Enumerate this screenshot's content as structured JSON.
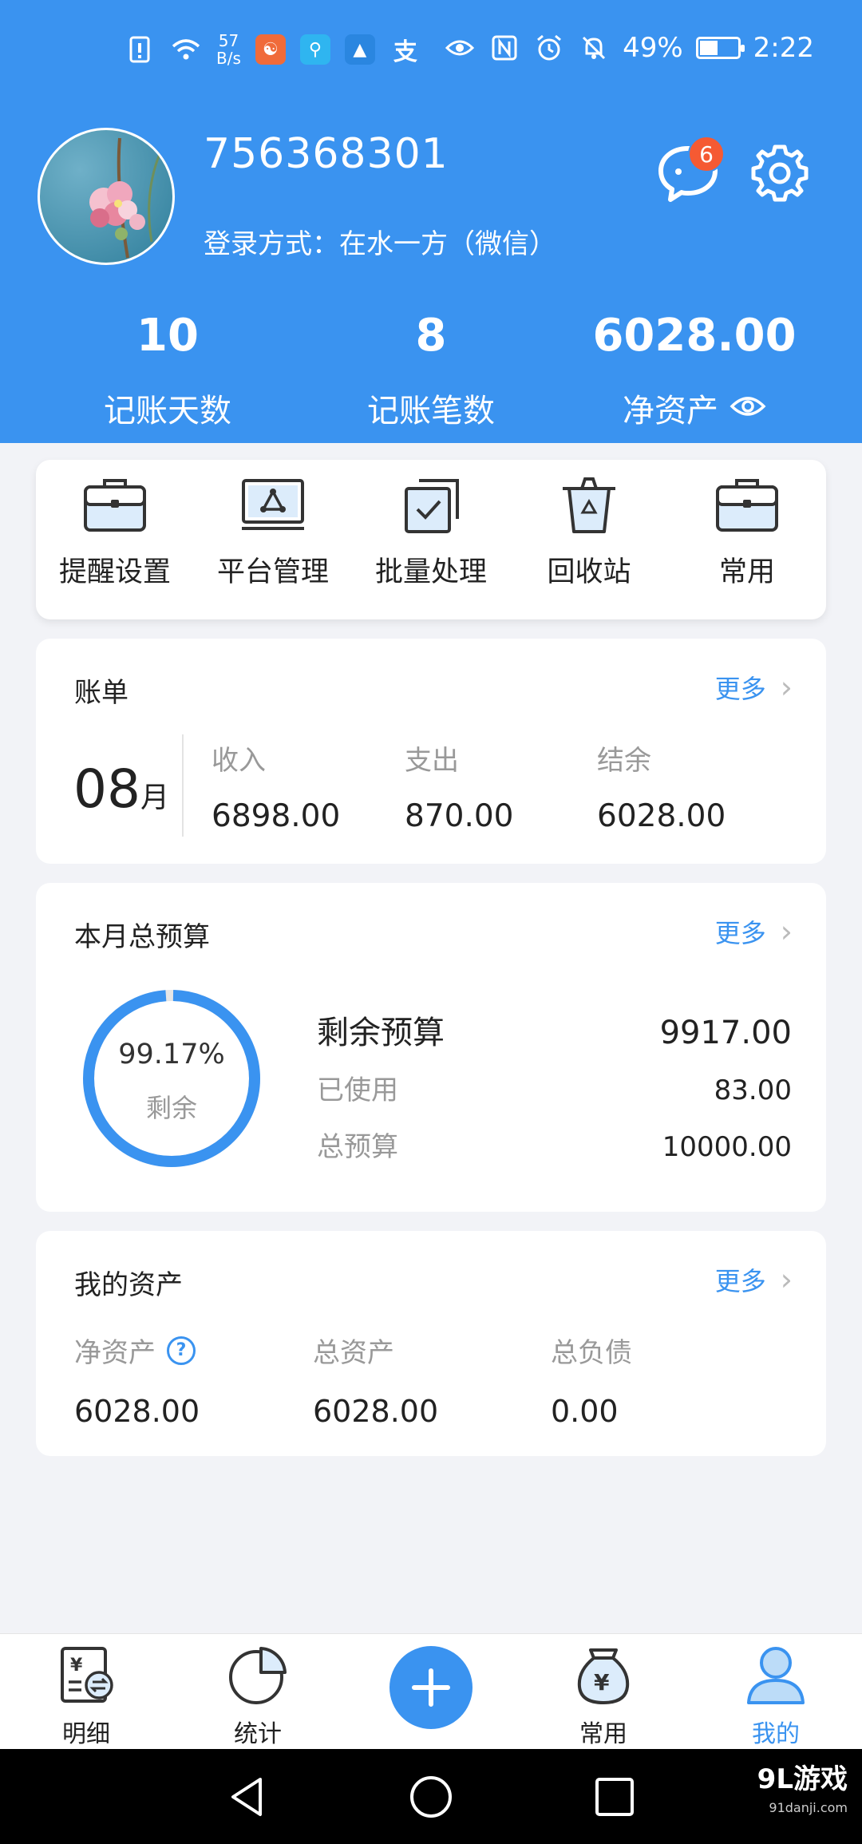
{
  "status_bar": {
    "net_speed_value": "57",
    "net_speed_unit": "B/s",
    "battery": "49%",
    "time": "2:22"
  },
  "profile": {
    "user_id": "756368301",
    "login_method": "登录方式：在水一方（微信）",
    "message_count": "6"
  },
  "stats": [
    {
      "value": "10",
      "label": "记账天数"
    },
    {
      "value": "8",
      "label": "记账笔数"
    },
    {
      "value": "6028.00",
      "label": "净资产"
    }
  ],
  "tools": [
    {
      "label": "提醒设置",
      "icon": "briefcase-icon"
    },
    {
      "label": "平台管理",
      "icon": "platform-icon"
    },
    {
      "label": "批量处理",
      "icon": "batch-check-icon"
    },
    {
      "label": "回收站",
      "icon": "recycle-bin-icon"
    },
    {
      "label": "常用",
      "icon": "briefcase-icon"
    }
  ],
  "bill": {
    "title": "账单",
    "more": "更多",
    "month": "08",
    "month_unit": "月",
    "columns": [
      {
        "label": "收入",
        "value": "6898.00"
      },
      {
        "label": "支出",
        "value": "870.00"
      },
      {
        "label": "结余",
        "value": "6028.00"
      }
    ]
  },
  "budget": {
    "title": "本月总预算",
    "more": "更多",
    "ring_percent": "99.17%",
    "ring_fraction_remaining": 0.9917,
    "ring_label": "剩余",
    "rows": [
      {
        "label": "剩余预算",
        "value": "9917.00"
      },
      {
        "label": "已使用",
        "value": "83.00"
      },
      {
        "label": "总预算",
        "value": "10000.00"
      }
    ]
  },
  "assets": {
    "title": "我的资产",
    "more": "更多",
    "columns": [
      {
        "label": "净资产",
        "value": "6028.00"
      },
      {
        "label": "总资产",
        "value": "6028.00"
      },
      {
        "label": "总负债",
        "value": "0.00"
      }
    ]
  },
  "tabbar": [
    {
      "label": "明细",
      "icon": "ledger-icon"
    },
    {
      "label": "统计",
      "icon": "pie-chart-icon"
    },
    {
      "label": "",
      "icon": "plus-icon"
    },
    {
      "label": "常用",
      "icon": "money-bag-icon"
    },
    {
      "label": "我的",
      "icon": "user-icon",
      "active": true
    }
  ],
  "watermark": {
    "brand": "9L游戏",
    "site": "91danji.com"
  },
  "colors": {
    "primary": "#3a93f0",
    "badge": "#f55a33",
    "background": "#f2f3f7"
  }
}
